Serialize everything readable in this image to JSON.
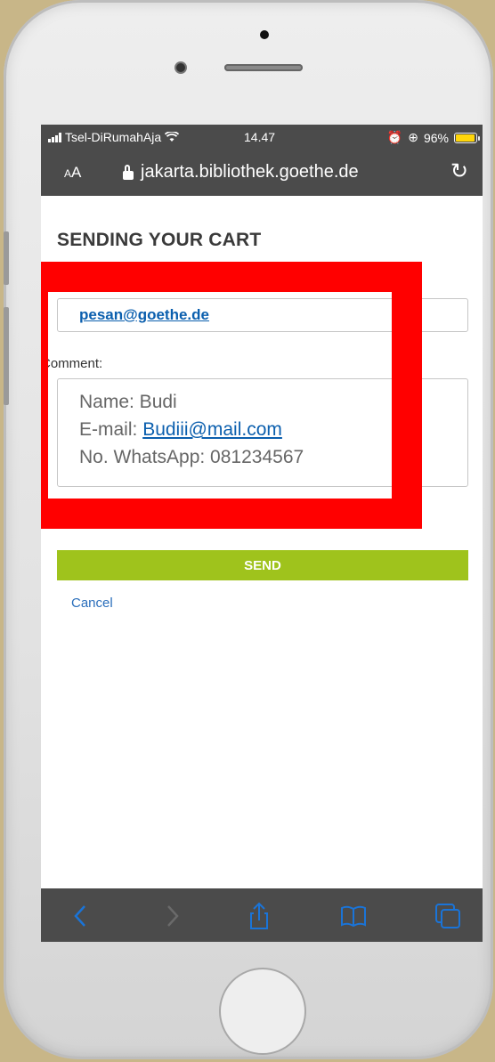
{
  "status_bar": {
    "carrier": "Tsel-DiRumahAja",
    "time": "14.47",
    "battery": "96%",
    "battery_level": 0.96
  },
  "address_bar": {
    "text_size_button": "AA",
    "url": "jakarta.bibliothek.goethe.de"
  },
  "page": {
    "title": "SENDING YOUR CART",
    "recipient_email": "pesan@goethe.de",
    "comment_label": "Comment:",
    "comment": {
      "line1": "Name: Budi",
      "email_prefix": "E-mail: ",
      "email_link": "Budiii@mail.com",
      "line3": "No. WhatsApp: 081234567"
    },
    "send_label": "SEND",
    "cancel_label": "Cancel"
  },
  "colors": {
    "send_button": "#9fc31c",
    "highlight": "#ff0000",
    "link": "#0b5fae",
    "browser_chrome": "#4b4b4b",
    "toolbar_icons": "#1a74d8"
  },
  "icons": {
    "back": "chevron-left-icon",
    "forward": "chevron-right-icon",
    "share": "share-icon",
    "bookmarks": "book-icon",
    "tabs": "tabs-icon"
  }
}
